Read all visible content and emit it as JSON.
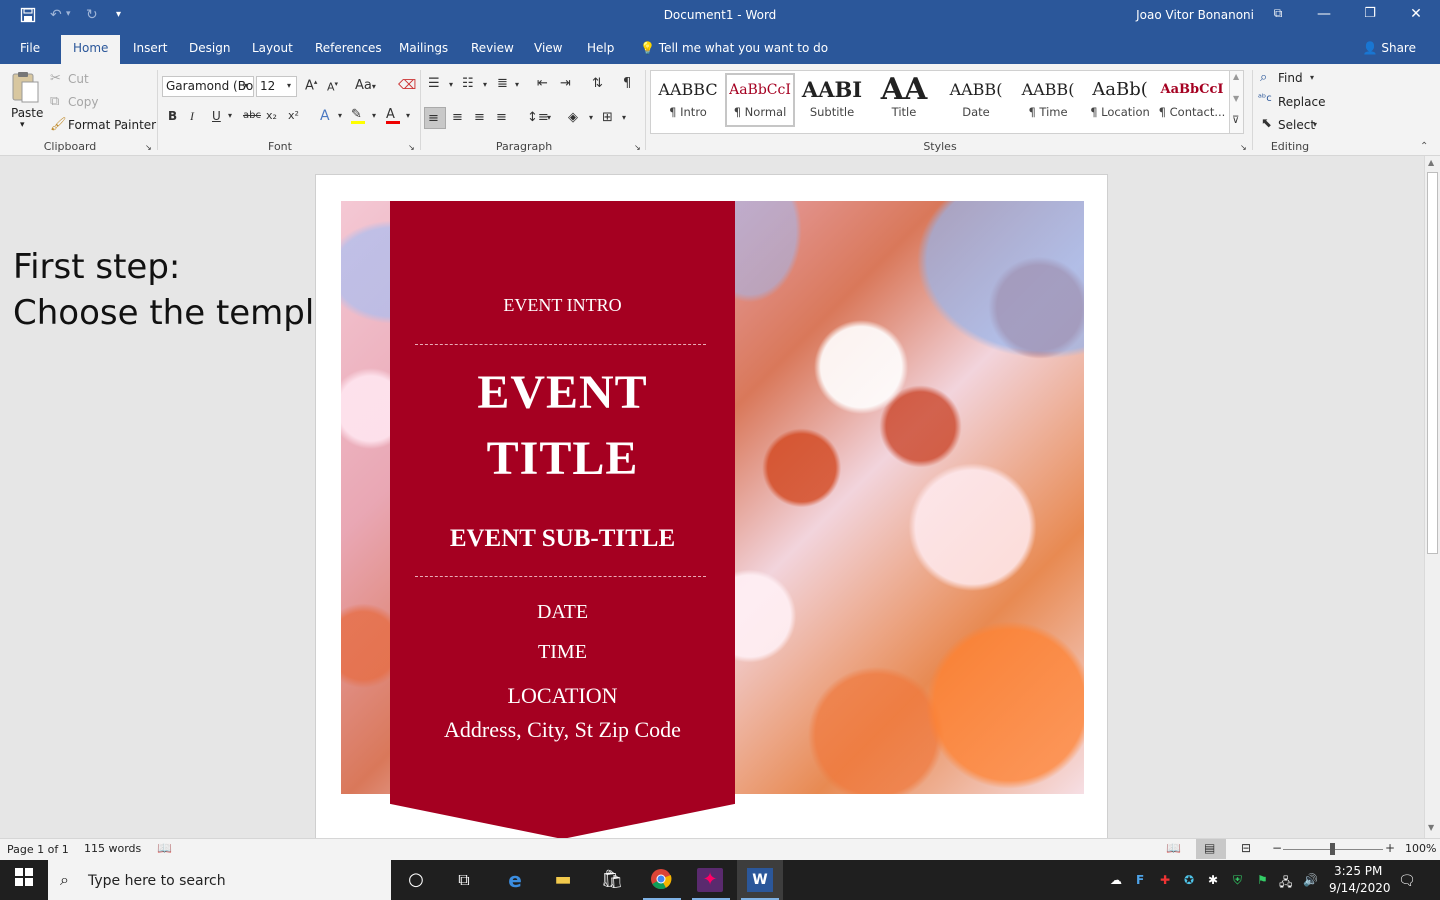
{
  "titlebar": {
    "doc_title": "Document1  -  Word",
    "user": "Joao Vitor Bonanoni",
    "qa_save_icon": "save-icon",
    "qa_undo_icon": "undo-icon",
    "qa_redo_icon": "redo-icon"
  },
  "tabs": [
    "File",
    "Home",
    "Insert",
    "Design",
    "Layout",
    "References",
    "Mailings",
    "Review",
    "View",
    "Help"
  ],
  "tell_me": "Tell me what you want to do",
  "share": "Share",
  "ribbon": {
    "clipboard": {
      "paste": "Paste",
      "cut": "Cut",
      "copy": "Copy",
      "format_painter": "Format Painter",
      "label": "Clipboard"
    },
    "font": {
      "name": "Garamond (Bo",
      "size": "12",
      "case": "Aa",
      "bold": "B",
      "italic": "I",
      "underline": "U",
      "strike": "abc",
      "sub": "x₂",
      "sup": "x²",
      "label": "Font"
    },
    "paragraph": {
      "label": "Paragraph"
    },
    "styles": {
      "label": "Styles",
      "items": [
        {
          "preview": "AABBC",
          "name": "¶ Intro"
        },
        {
          "preview": "AaBbCcI",
          "name": "¶ Normal"
        },
        {
          "preview": "AABI",
          "name": "Subtitle"
        },
        {
          "preview": "AA",
          "name": "Title"
        },
        {
          "preview": "AABB(",
          "name": "Date"
        },
        {
          "preview": "AABB(",
          "name": "¶ Time"
        },
        {
          "preview": "AaBb(",
          "name": "¶ Location"
        },
        {
          "preview": "AaBbCcI",
          "name": "¶ Contact..."
        }
      ]
    },
    "editing": {
      "find": "Find",
      "replace": "Replace",
      "select": "Select",
      "label": "Editing"
    }
  },
  "side_note": {
    "line1": "First step:",
    "line2": "Choose the template"
  },
  "flyer": {
    "intro": "EVENT INTRO",
    "title1": "EVENT",
    "title2": "TITLE",
    "subtitle": "EVENT SUB-TITLE",
    "date": "DATE",
    "time": "TIME",
    "location": "LOCATION",
    "address": "Address, City, St Zip Code",
    "banner_color": "#a50021"
  },
  "status": {
    "page": "Page 1 of 1",
    "words": "115 words",
    "zoom": "100%"
  },
  "taskbar": {
    "search_placeholder": "Type here to search",
    "time": "3:25 PM",
    "date": "9/14/2020"
  }
}
